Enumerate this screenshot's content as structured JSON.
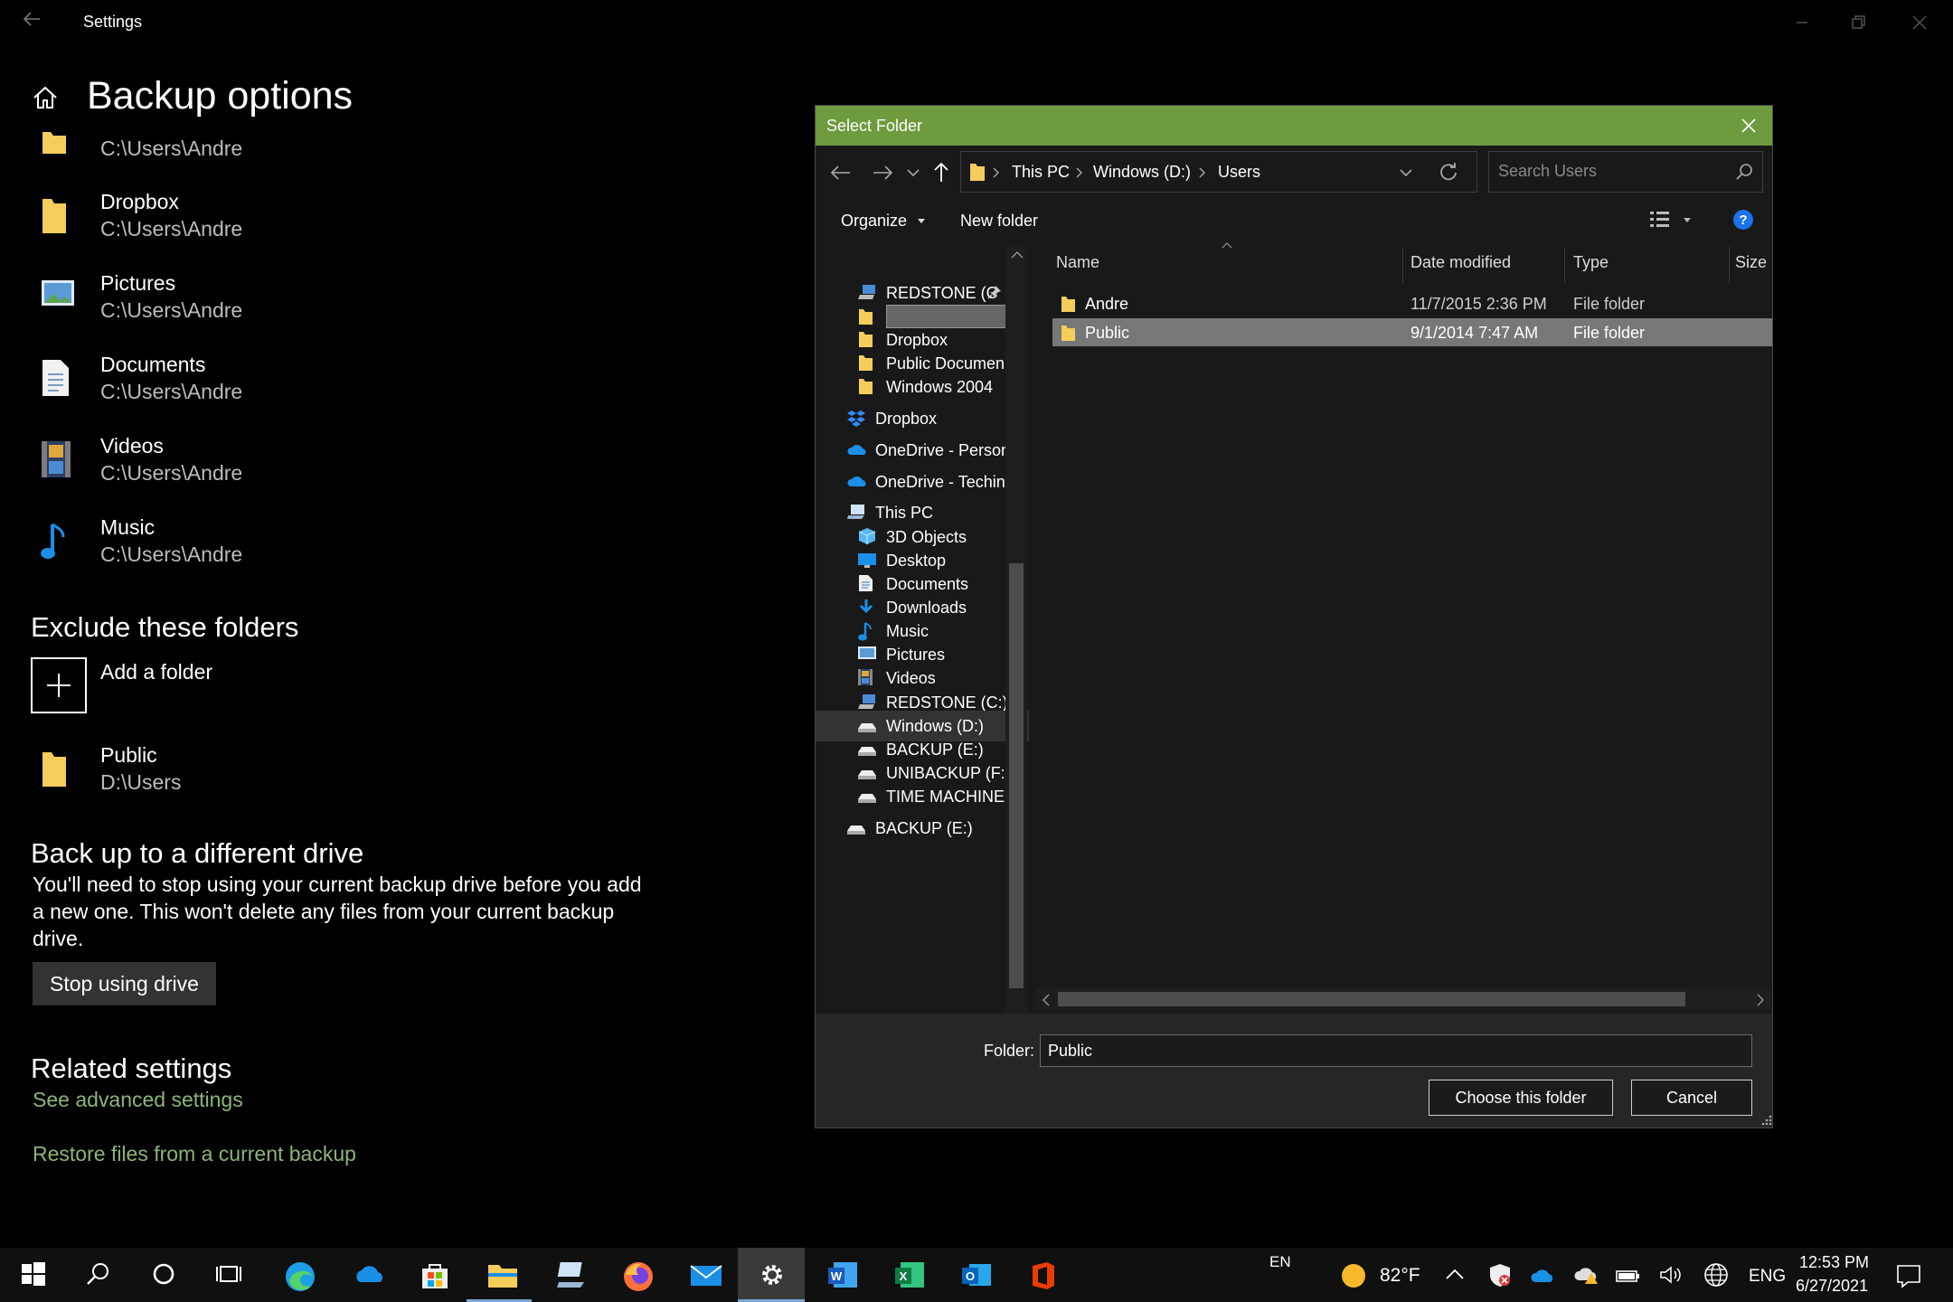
{
  "settings": {
    "app_title": "Settings",
    "page_title": "Backup options",
    "folders": [
      {
        "name": "",
        "path": "C:\\Users\\Andre",
        "icon": "folder-icon"
      },
      {
        "name": "Dropbox",
        "path": "C:\\Users\\Andre",
        "icon": "folder-icon"
      },
      {
        "name": "Pictures",
        "path": "C:\\Users\\Andre",
        "icon": "pictures-icon"
      },
      {
        "name": "Documents",
        "path": "C:\\Users\\Andre",
        "icon": "documents-icon"
      },
      {
        "name": "Videos",
        "path": "C:\\Users\\Andre",
        "icon": "videos-icon"
      },
      {
        "name": "Music",
        "path": "C:\\Users\\Andre",
        "icon": "music-icon"
      }
    ],
    "exclude_heading": "Exclude these folders",
    "add_folder_label": "Add a folder",
    "excluded": {
      "name": "Public",
      "path": "D:\\Users"
    },
    "different_drive_heading": "Back up to a different drive",
    "different_drive_text": "You'll need to stop using your current backup drive before you add a new one. This won't delete any files from your current backup drive.",
    "stop_button": "Stop using drive",
    "related_heading": "Related settings",
    "advanced_link": "See advanced settings",
    "restore_link": "Restore files from a current backup"
  },
  "dialog": {
    "title": "Select Folder",
    "breadcrumb": [
      "This PC",
      "Windows (D:)",
      "Users"
    ],
    "search_placeholder": "Search Users",
    "organize_label": "Organize",
    "new_folder_label": "New folder",
    "nav_items": [
      {
        "label": "REDSTONE (C",
        "icon": "drive-c-icon",
        "indent": 2,
        "pinned": true
      },
      {
        "label": "",
        "icon": "folder-icon",
        "indent": 2,
        "redacted": true
      },
      {
        "label": "Dropbox",
        "icon": "folder-icon",
        "indent": 2
      },
      {
        "label": "Public Documen",
        "icon": "folder-icon",
        "indent": 2
      },
      {
        "label": "Windows 2004",
        "icon": "folder-icon",
        "indent": 2
      },
      {
        "label": "Dropbox",
        "icon": "dropbox-icon",
        "indent": 1
      },
      {
        "label": "OneDrive - Person",
        "icon": "onedrive-icon",
        "indent": 1
      },
      {
        "label": "OneDrive - Teching",
        "icon": "onedrive-icon",
        "indent": 1
      },
      {
        "label": "This PC",
        "icon": "this-pc-icon",
        "indent": 1
      },
      {
        "label": "3D Objects",
        "icon": "3d-objects-icon",
        "indent": 2
      },
      {
        "label": "Desktop",
        "icon": "desktop-icon",
        "indent": 2
      },
      {
        "label": "Documents",
        "icon": "documents-icon",
        "indent": 2
      },
      {
        "label": "Downloads",
        "icon": "downloads-icon",
        "indent": 2
      },
      {
        "label": "Music",
        "icon": "music-icon",
        "indent": 2
      },
      {
        "label": "Pictures",
        "icon": "pictures-icon",
        "indent": 2
      },
      {
        "label": "Videos",
        "icon": "videos-icon",
        "indent": 2
      },
      {
        "label": "REDSTONE (C:)",
        "icon": "drive-c-icon",
        "indent": 2
      },
      {
        "label": "Windows (D:)",
        "icon": "drive-icon",
        "indent": 2,
        "selected": true
      },
      {
        "label": "BACKUP (E:)",
        "icon": "drive-icon",
        "indent": 2
      },
      {
        "label": "UNIBACKUP (F:)",
        "icon": "drive-icon",
        "indent": 2
      },
      {
        "label": "TIME MACHINE (",
        "icon": "drive-icon",
        "indent": 2
      },
      {
        "label": "BACKUP (E:)",
        "icon": "drive-icon",
        "indent": 1
      }
    ],
    "columns": [
      "Name",
      "Date modified",
      "Type",
      "Size"
    ],
    "files": [
      {
        "name": "Andre",
        "date": "11/7/2015 2:36 PM",
        "type": "File folder",
        "selected": false
      },
      {
        "name": "Public",
        "date": "9/1/2014 7:47 AM",
        "type": "File folder",
        "selected": true
      }
    ],
    "folder_label": "Folder:",
    "folder_value": "Public",
    "choose_button": "Choose this folder",
    "cancel_button": "Cancel"
  },
  "taskbar": {
    "apps": [
      "start-icon",
      "search-icon",
      "cortana-icon",
      "task-view-icon",
      "edge-icon",
      "onedrive-icon",
      "store-icon",
      "file-explorer-icon",
      "remote-icon",
      "firefox-icon",
      "mail-icon",
      "settings-icon",
      "word-icon",
      "excel-icon",
      "outlook-icon",
      "office-icon"
    ],
    "input_lang": "EN",
    "weather": "82°F",
    "lang": "ENG",
    "time": "12:53 PM",
    "date": "6/27/2021"
  },
  "colors": {
    "dialog_title_bar": "#6f9b3f",
    "link": "#8db57a",
    "folder_yellow": "#f5cd5b",
    "accent_blue": "#1a8fe6"
  }
}
